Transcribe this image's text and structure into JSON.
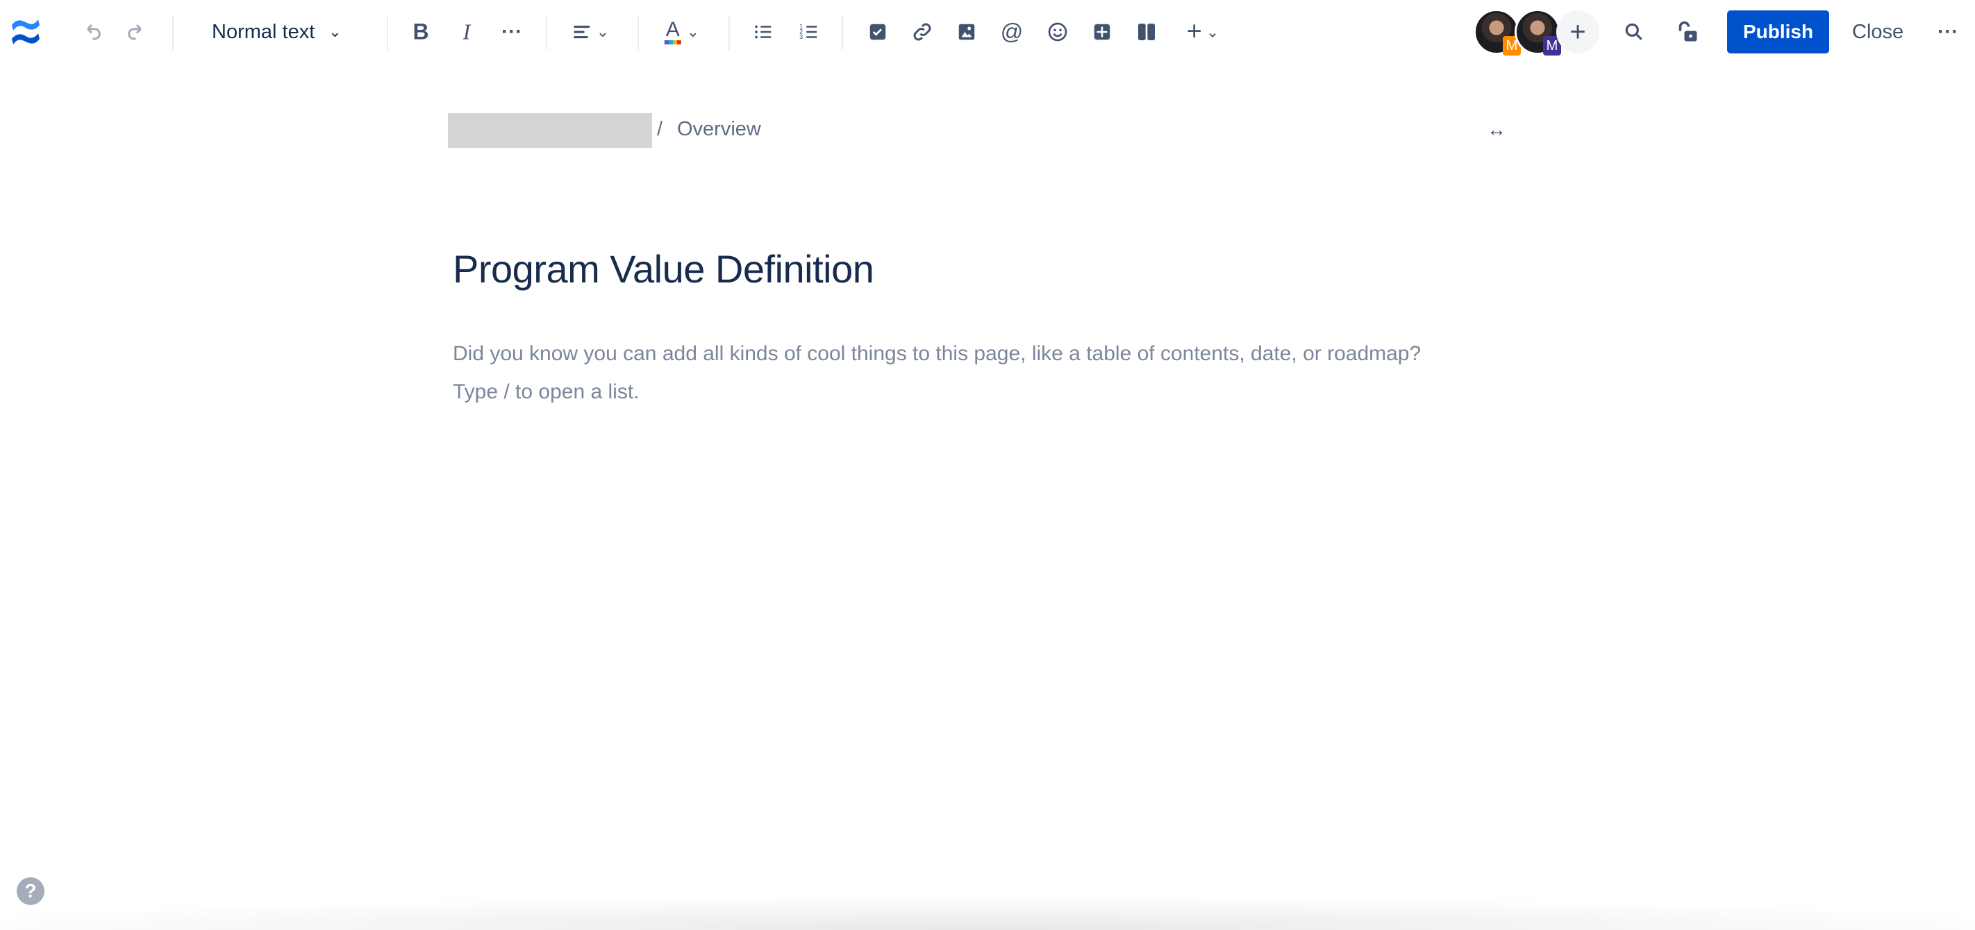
{
  "toolbar": {
    "text_style": "Normal text",
    "publish_label": "Publish",
    "close_label": "Close",
    "collaborators": [
      {
        "initial": "M",
        "color": "#ff8b00"
      },
      {
        "initial": "M",
        "color": "#403294"
      }
    ],
    "brand_color": "#0052cc"
  },
  "breadcrumb": {
    "separator": "/",
    "current": "Overview"
  },
  "page": {
    "title": "Program Value Definition",
    "placeholder_line1": "Did you know you can add all kinds of cool things to this page, like a table of contents, date, or roadmap?",
    "placeholder_line2": "Type / to open a list."
  }
}
